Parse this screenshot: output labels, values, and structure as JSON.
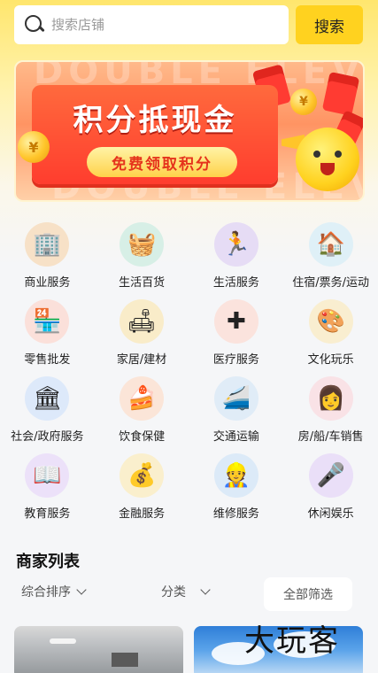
{
  "search": {
    "placeholder": "搜索店铺",
    "button_label": "搜索"
  },
  "banner": {
    "watermark": "DOUBLE ELEVEN",
    "title": "积分抵现金",
    "cta": "免费领取积分"
  },
  "categories": [
    {
      "label": "商业服务",
      "icon": "business-service-icon",
      "color": "#f7e1c7"
    },
    {
      "label": "生活百货",
      "icon": "groceries-basket-icon",
      "color": "#d7efe6"
    },
    {
      "label": "生活服务",
      "icon": "treadmill-icon",
      "color": "#e6dcf5"
    },
    {
      "label": "住宿/票务/运动",
      "icon": "house-icon",
      "color": "#dff0f7"
    },
    {
      "label": "零售批发",
      "icon": "shop-icon",
      "color": "#fbe0da"
    },
    {
      "label": "家居/建材",
      "icon": "sofa-icon",
      "color": "#f9ecc9"
    },
    {
      "label": "医疗服务",
      "icon": "medical-kit-icon",
      "color": "#fbe3dd"
    },
    {
      "label": "文化玩乐",
      "icon": "palette-icon",
      "color": "#f9eed0"
    },
    {
      "label": "社会/政府服务",
      "icon": "government-building-icon",
      "color": "#dde9fa"
    },
    {
      "label": "饮食保健",
      "icon": "cake-icon",
      "color": "#fbe5d8"
    },
    {
      "label": "交通运输",
      "icon": "train-icon",
      "color": "#e0ecf7"
    },
    {
      "label": "房/船/车销售",
      "icon": "agent-avatar-icon",
      "color": "#f9e2e6"
    },
    {
      "label": "教育服务",
      "icon": "book-icon",
      "color": "#ece1f9"
    },
    {
      "label": "金融服务",
      "icon": "coins-basket-icon",
      "color": "#faefcd"
    },
    {
      "label": "维修服务",
      "icon": "repair-worker-icon",
      "color": "#dceaf8"
    },
    {
      "label": "休闲娱乐",
      "icon": "microphone-icon",
      "color": "#eadff8"
    }
  ],
  "merchants": {
    "title": "商家列表",
    "filters": {
      "sort_label": "综合排序",
      "category_label": "分类",
      "all_filter_label": "全部筛选"
    }
  },
  "watermark": "大玩客",
  "colors": {
    "accent": "#ffd21f",
    "banner_red": "#ff3d2e"
  }
}
